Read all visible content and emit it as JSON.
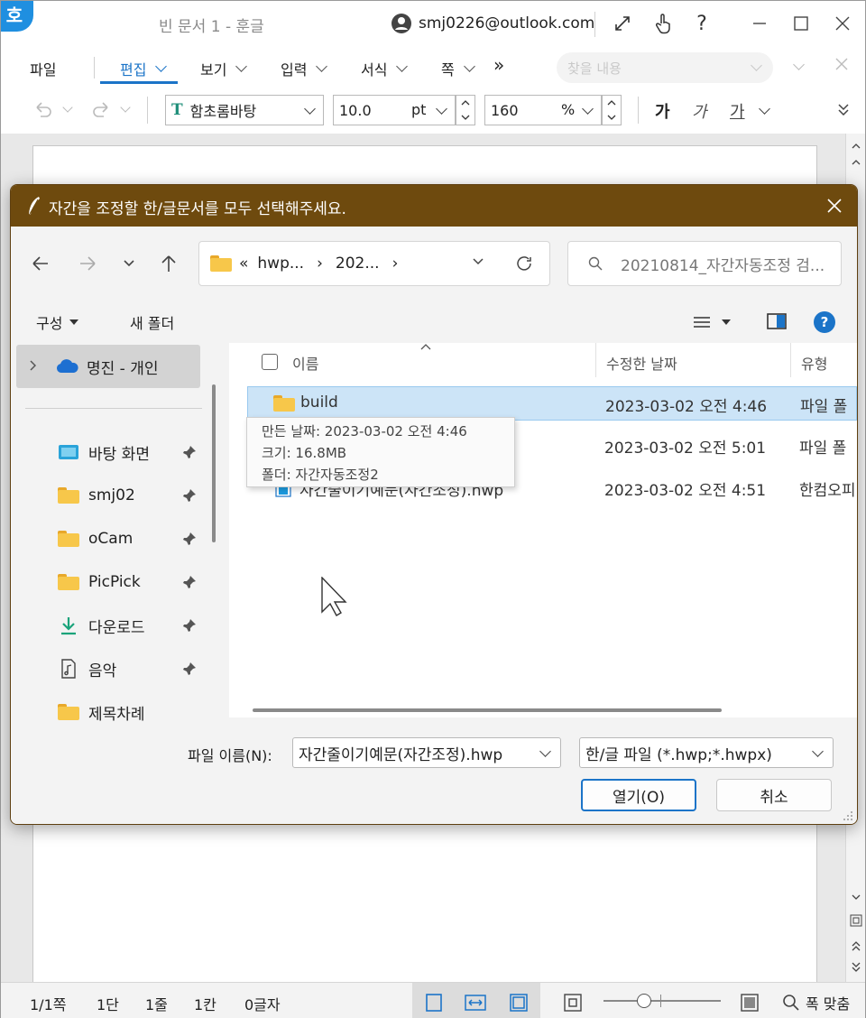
{
  "app": {
    "logo": "호",
    "doc_title": "빈 문서 1 - 훈글",
    "account": "smj0226@outlook.com"
  },
  "menus": {
    "file": "파일",
    "edit": "편집",
    "view": "보기",
    "insert": "입력",
    "format": "서식",
    "page": "쪽",
    "more": "»",
    "find_placeholder": "찾을 내용"
  },
  "toolbar": {
    "font": "함초롬바탕",
    "size": "10.0",
    "size_unit": "pt",
    "line_spacing": "160",
    "line_spacing_unit": "%",
    "bold": "가",
    "italic": "가",
    "underline": "가"
  },
  "status": {
    "page": "1/1쪽",
    "section": "1단",
    "line": "1줄",
    "col": "1칸",
    "chars": "0글자",
    "fit": "폭 맞춤"
  },
  "dialog": {
    "title": "자간을 조정할 한/글문서를 모두 선택해주세요.",
    "address": [
      "«",
      "hwp...",
      "›",
      "202...",
      "›"
    ],
    "search_placeholder": "20210814_자간자동조정 검...",
    "organize": "구성",
    "new_folder": "새 폴더",
    "nav": {
      "onedrive": "명진 - 개인",
      "items": [
        {
          "label": "바탕 화면",
          "icon": "desktop-icon"
        },
        {
          "label": "smj02",
          "icon": "folder-icon"
        },
        {
          "label": "oCam",
          "icon": "folder-icon"
        },
        {
          "label": "PicPick",
          "icon": "folder-icon"
        },
        {
          "label": "다운로드",
          "icon": "download-icon"
        },
        {
          "label": "음악",
          "icon": "music-icon"
        },
        {
          "label": "제목차례",
          "icon": "folder-icon"
        }
      ]
    },
    "columns": {
      "name": "이름",
      "modified": "수정한 날짜",
      "type": "유형"
    },
    "files": [
      {
        "name": "build",
        "modified": "2023-03-02 오전 4:46",
        "type": "파일 폴",
        "icon": "folder-icon"
      },
      {
        "name": "",
        "modified": "2023-03-02 오전 5:01",
        "type": "파일 폴",
        "icon": "folder-icon"
      },
      {
        "name": "자간줄이기예문(자간조정).hwp",
        "modified": "2023-03-02 오전 4:51",
        "type": "한컴오피",
        "icon": "hwp-file-icon"
      }
    ],
    "tooltip": {
      "created": "만든 날짜: 2023-03-02 오전 4:46",
      "size": "크기: 16.8MB",
      "folders": "폴더: 자간자동조정2"
    },
    "filename_label": "파일 이름(N):",
    "filename_value": "자간줄이기예문(자간조정).hwp",
    "filetype_value": "한/글 파일 (*.hwp;*.hwpx)",
    "open_label": "열기(O)",
    "cancel_label": "취소"
  },
  "colors": {
    "accent": "#1b74c8",
    "dialog_title_bg": "#6e4a0e",
    "selection": "#cce4f7",
    "folder": "#f7c74a"
  }
}
